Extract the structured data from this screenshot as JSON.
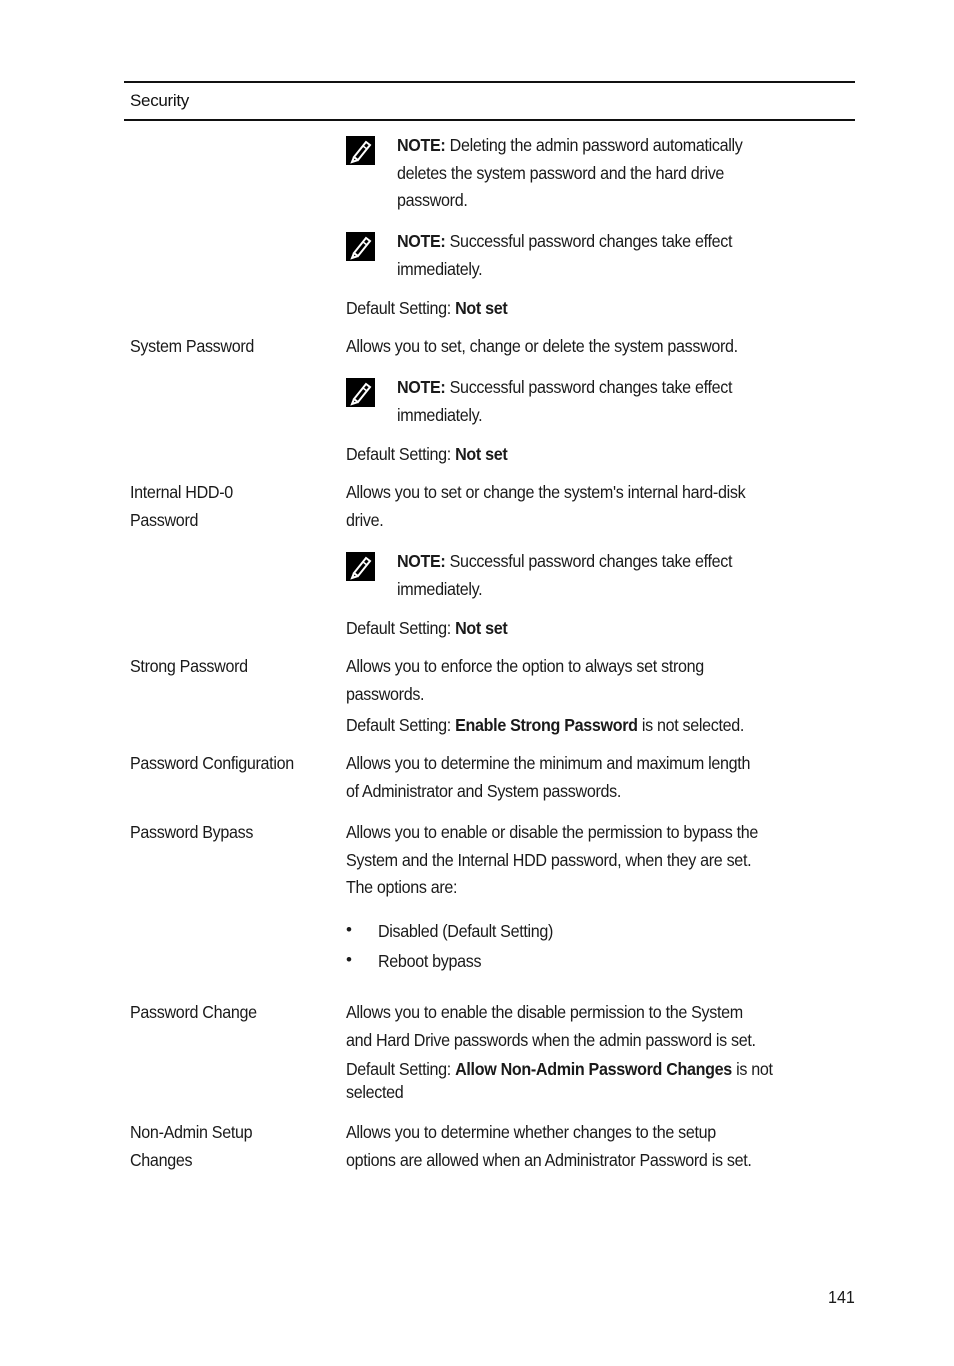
{
  "table": {
    "header": "Security",
    "admin_notes": [
      {
        "label": "NOTE:",
        "lines": [
          "Deleting the admin password automatically",
          "deletes the system password and the hard drive",
          "password."
        ]
      },
      {
        "label": "NOTE:",
        "lines": [
          "Successful password changes take effect",
          "immediately."
        ]
      }
    ],
    "admin_default": {
      "prefix": "Default Setting:",
      "value": "Not set"
    },
    "rows": [
      {
        "name": "system-password",
        "label_lines": [
          "System Password"
        ],
        "desc_lines": [
          "Allows you to set, change or delete the system password."
        ],
        "note": {
          "label": "NOTE:",
          "lines": [
            "Successful password changes take effect",
            "immediately."
          ]
        },
        "default": {
          "prefix": "Default Setting:",
          "value": "Not set"
        }
      },
      {
        "name": "internal-hdd-password",
        "label_lines": [
          "Internal HDD-0",
          "Password"
        ],
        "desc_lines": [
          "Allows you to set or change the system's internal hard-disk",
          "drive."
        ],
        "note": {
          "label": "NOTE:",
          "lines": [
            "Successful password changes take effect",
            "immediately."
          ]
        },
        "default": {
          "prefix": "Default Setting:",
          "value": "Not set"
        }
      },
      {
        "name": "strong-password",
        "label_lines": [
          "Strong Password"
        ],
        "desc_lines": [
          "Allows you to enforce the option to always set strong",
          "passwords."
        ],
        "default": {
          "prefix": "Default Setting:",
          "value": "Enable Strong Password",
          "suffix": "is not selected."
        }
      },
      {
        "name": "password-configuration",
        "label_lines": [
          "Password Configuration"
        ],
        "desc_lines": [
          "Allows you to determine the minimum and maximum length",
          "of Administrator and System passwords."
        ]
      },
      {
        "name": "password-bypass",
        "label_lines": [
          "Password Bypass"
        ],
        "desc_lines": [
          "Allows you to enable or disable the permission to bypass the",
          "System and the Internal HDD password, when they are set.",
          "The options are:"
        ],
        "options": [
          "Disabled (Default Setting)",
          "Reboot bypass"
        ]
      },
      {
        "name": "password-change",
        "label_lines": [
          "Password Change"
        ],
        "desc_lines": [
          "Allows you to enable the disable permission to the System",
          "and Hard Drive passwords when the admin password is set."
        ],
        "default": {
          "prefix": "Default Setting:",
          "value": "Allow Non-Admin Password Changes",
          "suffix": "is not",
          "suffix2": "selected"
        }
      },
      {
        "name": "non-admin-setup-changes",
        "label_lines": [
          "Non-Admin Setup",
          "Changes"
        ],
        "desc_lines": [
          "Allows you to determine whether changes to the setup",
          "options are allowed when an Administrator Password is set."
        ]
      }
    ]
  },
  "page_number": "141"
}
